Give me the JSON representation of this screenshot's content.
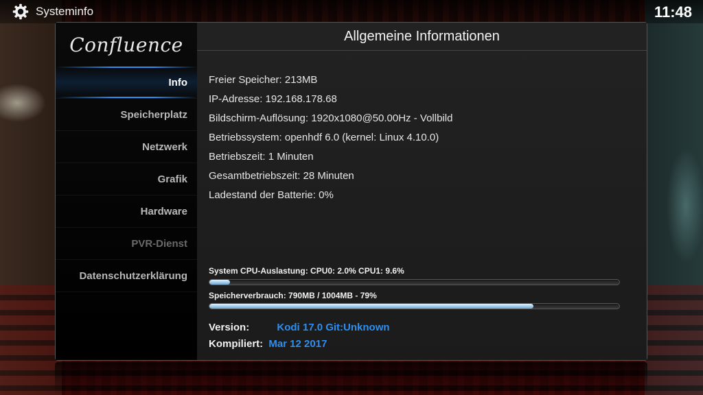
{
  "window": {
    "title": "Systeminfo",
    "clock": "11:48"
  },
  "logo": "Confluence",
  "menu": [
    {
      "label": "Info",
      "state": "active"
    },
    {
      "label": "Speicherplatz",
      "state": "normal"
    },
    {
      "label": "Netzwerk",
      "state": "normal"
    },
    {
      "label": "Grafik",
      "state": "normal"
    },
    {
      "label": "Hardware",
      "state": "normal"
    },
    {
      "label": "PVR-Dienst",
      "state": "disabled"
    },
    {
      "label": "Datenschutzerklärung",
      "state": "normal"
    }
  ],
  "content": {
    "title": "Allgemeine Informationen",
    "lines": [
      "Freier Speicher: 213MB",
      "IP-Adresse: 192.168.178.68",
      "Bildschirm-Auflösung: 1920x1080@50.00Hz - Vollbild",
      "Betriebssystem: openhdf 6.0 (kernel: Linux 4.10.0)",
      "Betriebszeit: 1 Minuten",
      "Gesamtbetriebszeit: 28 Minuten",
      "Ladestand der Batterie: 0%"
    ],
    "cpu": {
      "label": "System CPU-Auslastung: CPU0: 2.0% CPU1: 9.6%",
      "percent": 5
    },
    "memory": {
      "label": "Speicherverbrauch: 790MB / 1004MB - 79%",
      "percent": 79
    },
    "version": {
      "key": "Version:",
      "value": "Kodi 17.0 Git:Unknown"
    },
    "compiled": {
      "key": "Kompiliert:",
      "value": "Mar 12 2017"
    }
  },
  "colors": {
    "accent": "#2d8ff0",
    "panel": "#000000"
  },
  "icons": {
    "top": "gear-icon"
  }
}
